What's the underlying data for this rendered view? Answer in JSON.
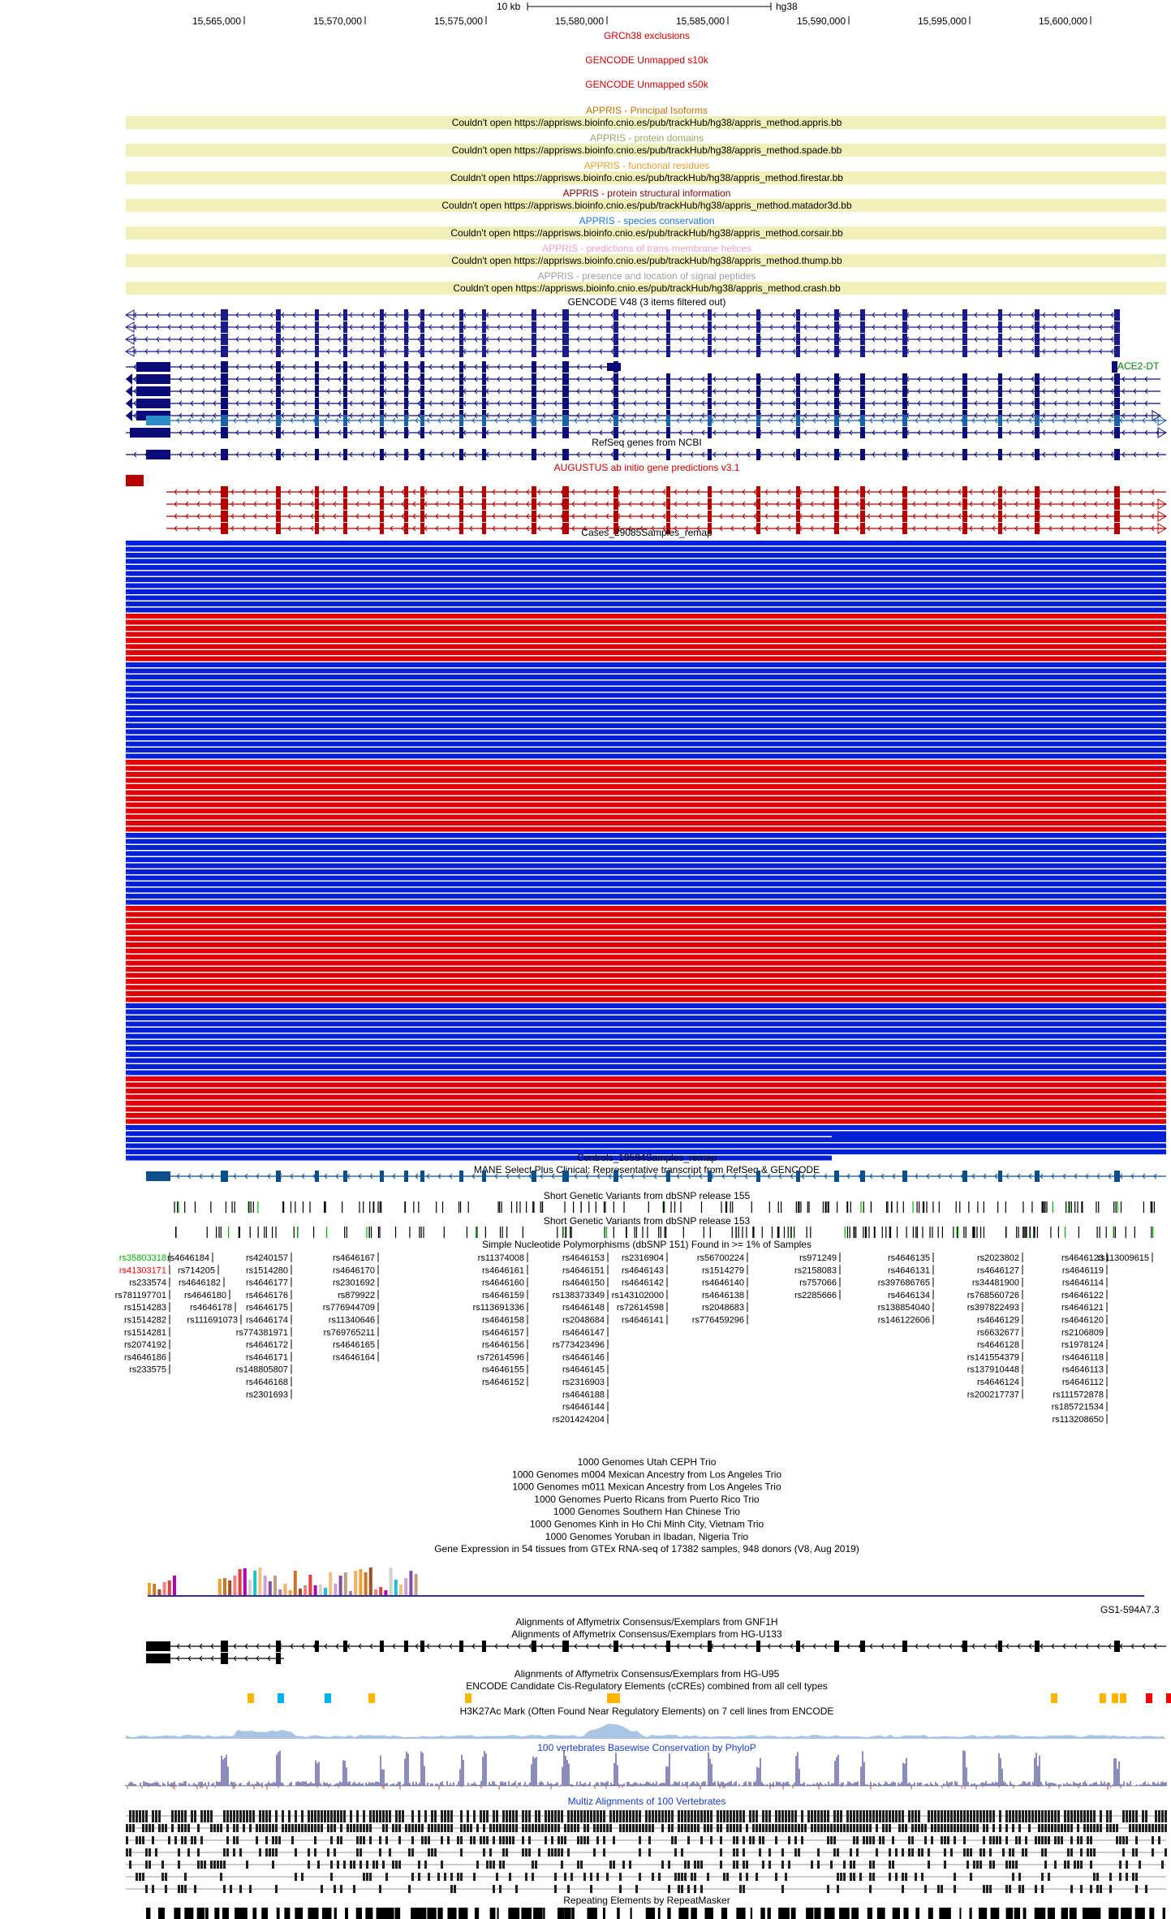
{
  "header": {
    "scale_label": "10 kb",
    "assembly": "hg38"
  },
  "ruler": {
    "positions": [
      "15,565,000",
      "15,570,000",
      "15,575,000",
      "15,580,000",
      "15,585,000",
      "15,590,000",
      "15,595,000",
      "15,600,000"
    ]
  },
  "colors": {
    "exclusion_red": "#cc0000",
    "appris_band": "#f0f0b8",
    "gene_navy": "#0c0c78",
    "gencode_blue": "#1a1a8a",
    "augustus_red": "#b40000",
    "case_blue": "#0020d8",
    "case_red": "#e00000",
    "mane_blue": "#0b4f8a",
    "phylop_navy": "#1b1b7a",
    "ccre_orange": "#ffb400",
    "ccre_cyan": "#00b0f0",
    "ccre_red": "#ff0000"
  },
  "tracks": {
    "grch38_excl": "GRCh38 exclusions",
    "gencode_s10k": "GENCODE Unmapped s10k",
    "gencode_s50k": "GENCODE Unmapped s50k",
    "appris": [
      {
        "title": "APPRIS - Principal Isoforms",
        "color": "#c87000",
        "message": "Couldn't open https://apprisws.bioinfo.cnio.es/pub/trackHub/hg38/appris_method.appris.bb"
      },
      {
        "title": "APPRIS - protein domains",
        "color": "#9aaa60",
        "message": "Couldn't open https://apprisws.bioinfo.cnio.es/pub/trackHub/hg38/appris_method.spade.bb"
      },
      {
        "title": "APPRIS - functional residues",
        "color": "#e8a030",
        "message": "Couldn't open https://apprisws.bioinfo.cnio.es/pub/trackHub/hg38/appris_method.firestar.bb"
      },
      {
        "title": "APPRIS - protein structural information",
        "color": "#800000",
        "message": "Couldn't open https://apprisws.bioinfo.cnio.es/pub/trackHub/hg38/appris_method.matador3d.bb"
      },
      {
        "title": "APPRIS - species conservation",
        "color": "#1e78d8",
        "message": "Couldn't open https://apprisws.bioinfo.cnio.es/pub/trackHub/hg38/appris_method.corsair.bb"
      },
      {
        "title": "APPRIS - predictions of trans-membrane helices",
        "color": "#f0a0c8",
        "message": "Couldn't open https://apprisws.bioinfo.cnio.es/pub/trackHub/hg38/appris_method.thump.bb"
      },
      {
        "title": "APPRIS - presence and location of signal peptides",
        "color": "#a0a0a0",
        "message": "Couldn't open https://apprisws.bioinfo.cnio.es/pub/trackHub/hg38/appris_method.crash.bb"
      }
    ],
    "gencode": "GENCODE V48 (3 items filtered out)",
    "gene_label": "ACE2-DT",
    "refseq": "RefSeq genes from NCBI",
    "augustus": "AUGUSTUS ab initio gene predictions v3.1",
    "cases": "Cases_29085Samples_remap",
    "controls": "Controls_19584Samples_remap",
    "mane": "MANE Select Plus Clinical: Representative transcript from RefSeq & GENCODE",
    "dbsnp155": "Short Genetic Variants from dbSNP release 155",
    "dbsnp153": "Short Genetic Variants from dbSNP release 153",
    "snp151": "Simple Nucleotide Polymorphisms (dbSNP 151) Found in >= 1% of Samples",
    "trios": [
      "1000 Genomes Utah CEPH Trio",
      "1000 Genomes m004 Mexican Ancestry from Los Angeles Trio",
      "1000 Genomes m011 Mexican Ancestry from Los Angeles Trio",
      "1000 Genomes Puerto Ricans from Puerto Rico Trio",
      "1000 Genomes Southern Han Chinese Trio",
      "1000 Genomes Kinh in Ho Chi Minh City, Vietnam Trio",
      "1000 Genomes Yoruban in Ibadan, Nigeria Trio"
    ],
    "gtex": "Gene Expression in 54 tissues from GTEx RNA-seq of 17382 samples, 948 donors (V8, Aug 2019)",
    "gtex_gene": "GS1-594A7.3",
    "affy_gnf": "Alignments of Affymetrix Consensus/Exemplars from GNF1H",
    "affy_u133": "Alignments of Affymetrix Consensus/Exemplars from HG-U133",
    "affy_u95": "Alignments of Affymetrix Consensus/Exemplars from HG-U95",
    "encode_ccre": "ENCODE Candidate Cis-Regulatory Elements (cCREs) combined from all cell types",
    "h3k27ac": "H3K27Ac Mark (Often Found Near Regulatory Elements) on 7 cell lines from ENCODE",
    "phylop": "100 vertebrates Basewise Conservation by PhyloP",
    "multiz": "Multiz Alignments of 100 Vertebrates",
    "repeatmasker": "Repeating Elements by RepeatMasker"
  },
  "snp_columns": [
    {
      "items": [
        {
          "t": "rs35803318",
          "c": "#00b000"
        },
        {
          "t": "rs41303171",
          "c": "#ff0000"
        },
        {
          "t": "rs233574"
        },
        {
          "t": "rs781197701"
        },
        {
          "t": "rs1514283"
        },
        {
          "t": "rs1514282"
        },
        {
          "t": "rs1514281"
        },
        {
          "t": "rs2074192"
        },
        {
          "t": "rs4646186"
        },
        {
          "t": "rs233575"
        }
      ]
    },
    {
      "items": [
        {
          "t": "rs4646184"
        },
        {
          "t": "rs714205"
        },
        {
          "t": "rs4646182"
        },
        {
          "t": "rs4646180"
        },
        {
          "t": "rs4646178"
        },
        {
          "t": "rs111691073"
        }
      ]
    },
    {
      "items": [
        {
          "t": "rs4240157"
        },
        {
          "t": "rs1514280"
        },
        {
          "t": "rs4646177"
        },
        {
          "t": "rs4646176"
        },
        {
          "t": "rs4646175"
        },
        {
          "t": "rs4646174"
        },
        {
          "t": "rs774381971"
        },
        {
          "t": "rs4646172"
        },
        {
          "t": "rs4646171"
        },
        {
          "t": "rs148805807"
        },
        {
          "t": "rs4646168"
        },
        {
          "t": "rs2301693"
        }
      ]
    },
    {
      "items": [
        {
          "t": "rs4646167"
        },
        {
          "t": "rs4646170"
        },
        {
          "t": "rs2301692"
        },
        {
          "t": "rs879922"
        },
        {
          "t": "rs776944709"
        },
        {
          "t": "rs11340646"
        },
        {
          "t": "rs769765211"
        },
        {
          "t": "rs4646165"
        },
        {
          "t": "rs4646164"
        }
      ]
    },
    {
      "items": [
        {
          "t": "rs11374008"
        },
        {
          "t": "rs4646161"
        },
        {
          "t": "rs4646160"
        },
        {
          "t": "rs4646159"
        },
        {
          "t": "rs113691336"
        },
        {
          "t": "rs4646158"
        },
        {
          "t": "rs4646157"
        },
        {
          "t": "rs4646156"
        },
        {
          "t": "rs72614596"
        },
        {
          "t": "rs4646155"
        },
        {
          "t": "rs4646152"
        }
      ]
    },
    {
      "items": [
        {
          "t": "rs4646153"
        },
        {
          "t": "rs4646151"
        },
        {
          "t": "rs4646150"
        },
        {
          "t": "rs138373349"
        },
        {
          "t": "rs4646148"
        },
        {
          "t": "rs2048684"
        },
        {
          "t": "rs4646147"
        },
        {
          "t": "rs773423496"
        },
        {
          "t": "rs4646146"
        },
        {
          "t": "rs4646145"
        },
        {
          "t": "rs2316903"
        },
        {
          "t": "rs4646188"
        },
        {
          "t": "rs4646144"
        },
        {
          "t": "rs201424204"
        }
      ]
    },
    {
      "items": [
        {
          "t": "rs2316904"
        },
        {
          "t": "rs4646143"
        },
        {
          "t": "rs4646142"
        },
        {
          "t": "rs143102000"
        },
        {
          "t": "rs72614598"
        },
        {
          "t": "rs4646141"
        }
      ]
    },
    {
      "items": [
        {
          "t": "rs56700224"
        },
        {
          "t": "rs1514279"
        },
        {
          "t": "rs4646140"
        },
        {
          "t": "rs4646138"
        },
        {
          "t": "rs2048683"
        },
        {
          "t": "rs776459296"
        }
      ]
    },
    {
      "items": [
        {
          "t": "rs971249"
        },
        {
          "t": "rs2158083"
        },
        {
          "t": "rs757066"
        },
        {
          "t": "rs2285666"
        }
      ]
    },
    {
      "items": [
        {
          "t": "rs4646135"
        },
        {
          "t": "rs4646131"
        },
        {
          "t": "rs397686765"
        },
        {
          "t": "rs4646134"
        },
        {
          "t": "rs138854040"
        },
        {
          "t": "rs146122606"
        }
      ]
    },
    {
      "items": [
        {
          "t": "rs2023802"
        },
        {
          "t": "rs4646127"
        },
        {
          "t": "rs34481900"
        },
        {
          "t": "rs768560726"
        },
        {
          "t": "rs397822493"
        },
        {
          "t": "rs4646129"
        },
        {
          "t": "rs6632677"
        },
        {
          "t": "rs4646128"
        },
        {
          "t": "rs141554379"
        },
        {
          "t": "rs137910448"
        },
        {
          "t": "rs4646124"
        },
        {
          "t": "rs200217737"
        }
      ]
    },
    {
      "items": [
        {
          "t": "rs4646123"
        },
        {
          "t": "rs4646119"
        },
        {
          "t": "rs4646114"
        },
        {
          "t": "rs4646122"
        },
        {
          "t": "rs4646121"
        },
        {
          "t": "rs4646120"
        },
        {
          "t": "rs2106809"
        },
        {
          "t": "rs1978124"
        },
        {
          "t": "rs4646118"
        },
        {
          "t": "rs4646113"
        },
        {
          "t": "rs4646112"
        },
        {
          "t": "rs111572878"
        },
        {
          "t": "rs185721534"
        },
        {
          "t": "rs113208650"
        }
      ]
    },
    {
      "items": [
        {
          "t": "rs113009615"
        }
      ]
    }
  ]
}
